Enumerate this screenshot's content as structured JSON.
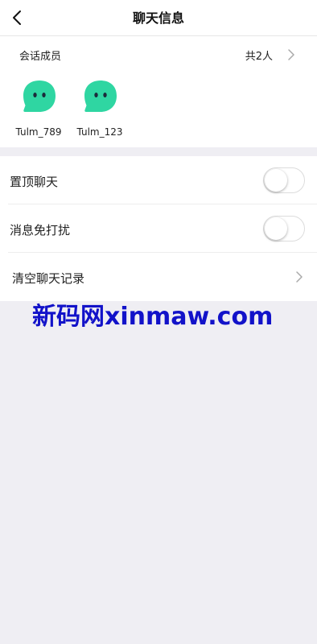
{
  "header": {
    "title": "聊天信息",
    "back_icon": "chevron-left-icon"
  },
  "members": {
    "label": "会话成员",
    "count_text": "共2人",
    "chevron_icon": "chevron-right-icon",
    "avatar_color": "#2fd6a2",
    "items": [
      {
        "name": "Tulm_789",
        "avatar_icon": "chat-bubble-avatar-icon"
      },
      {
        "name": "Tulm_123",
        "avatar_icon": "chat-bubble-avatar-icon"
      }
    ]
  },
  "settings": {
    "pin_chat": {
      "label": "置顶聊天",
      "enabled": false
    },
    "mute_notifications": {
      "label": "消息免打扰",
      "enabled": false
    },
    "clear_history": {
      "label": "清空聊天记录",
      "chevron_icon": "chevron-right-icon"
    }
  },
  "watermark": {
    "text": "新码网xinmaw.com",
    "color": "#1212c9"
  },
  "colors": {
    "background": "#efeef3",
    "card": "#ffffff",
    "accent_avatar": "#2fd6a2"
  }
}
